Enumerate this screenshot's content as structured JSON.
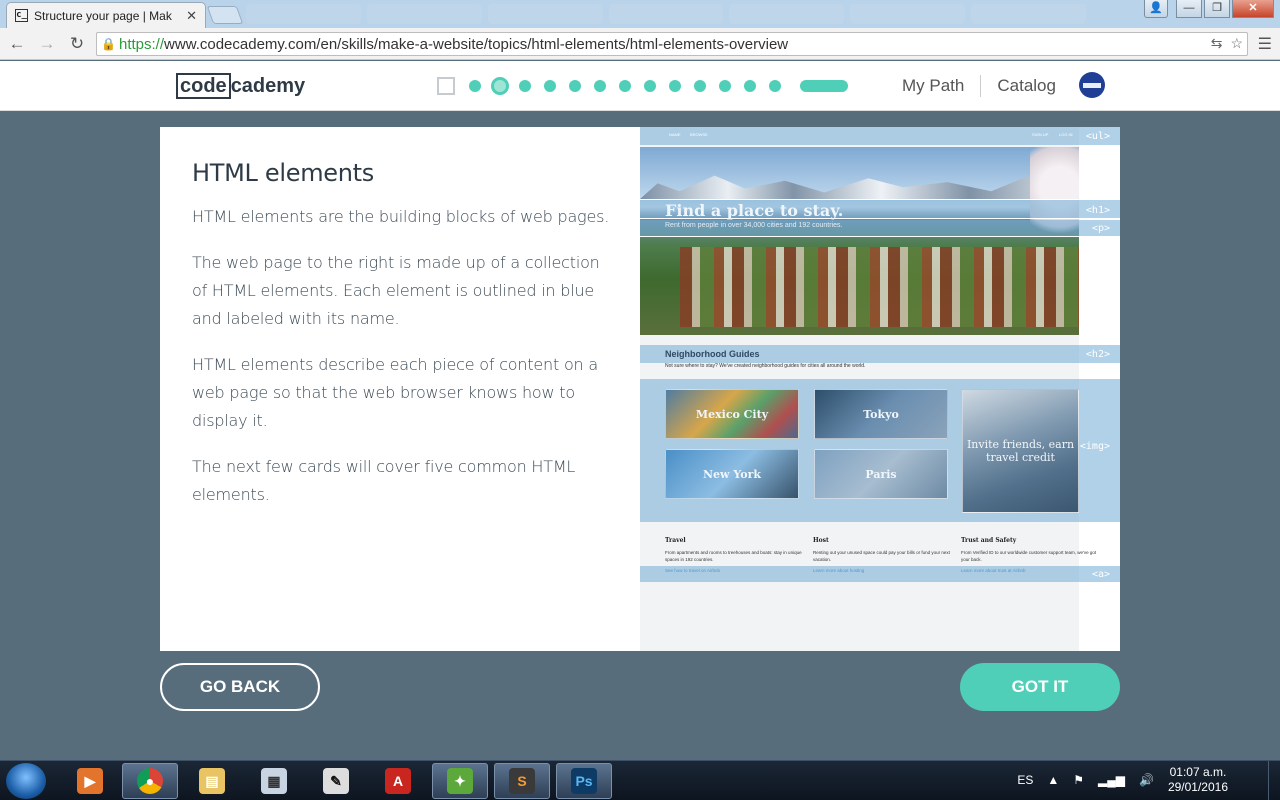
{
  "browser": {
    "tab_title": "Structure your page | Mak",
    "favicon_text": "c_",
    "url_https": "https://",
    "url_rest": "www.codecademy.com/en/skills/make-a-website/topics/html-elements/html-elements-overview"
  },
  "header": {
    "logo_boxed": "code",
    "logo_rest": "cademy",
    "nav": [
      "My Path",
      "Catalog"
    ]
  },
  "lesson": {
    "title": "HTML elements",
    "paragraphs": [
      "HTML elements are the building blocks of web pages.",
      "The web page to the right is made up of a collection of HTML elements. Each element is outlined in blue and labeled with its name.",
      "HTML elements describe each piece of content on a web page so that the web browser knows how to display it.",
      "The next few cards will cover five common HTML elements."
    ]
  },
  "illustration": {
    "tags": {
      "ul": "<ul>",
      "h1": "<h1>",
      "p": "<p>",
      "h2": "<h2>",
      "img": "<img>",
      "a": "<a>"
    },
    "mini_nav": [
      "NAME",
      "BROWSE",
      "SIGN UP",
      "LOG IN"
    ],
    "hero_title": "Find a place to stay.",
    "hero_sub": "Rent from people in over 34,000 cities and 192 countries.",
    "section_title": "Neighborhood Guides",
    "section_sub": "Not sure where to stay? We've created neighborhood guides for cities all around the world.",
    "cities": [
      "Mexico City",
      "Tokyo",
      "New York",
      "Paris",
      "Invite friends, earn travel credit"
    ],
    "features": [
      {
        "title": "Travel",
        "text": "From apartments and rooms to treehouses and boats: stay in unique spaces in 192 countries.",
        "link": "See how to travel on Airbnb"
      },
      {
        "title": "Host",
        "text": "Renting out your unused space could pay your bills or fund your next vacation.",
        "link": "Learn more about hosting"
      },
      {
        "title": "Trust and Safety",
        "text": "From Verified ID to our worldwide customer support team, we've got your back.",
        "link": "Learn more about trust at Airbnb"
      }
    ]
  },
  "buttons": {
    "back": "GO BACK",
    "got_it": "GOT IT"
  },
  "taskbar": {
    "lang": "ES",
    "time": "01:07 a.m.",
    "date": "29/01/2016",
    "apps": [
      "media-player-icon",
      "chrome-icon",
      "file-explorer-icon",
      "calculator-icon",
      "inkscape-icon",
      "autocad-icon",
      "sketchbook-icon",
      "sublime-text-icon",
      "photoshop-icon"
    ]
  },
  "colors": {
    "accent": "#4fcfb7",
    "page_bg": "#586d7b",
    "highlight": "#71acd6"
  }
}
